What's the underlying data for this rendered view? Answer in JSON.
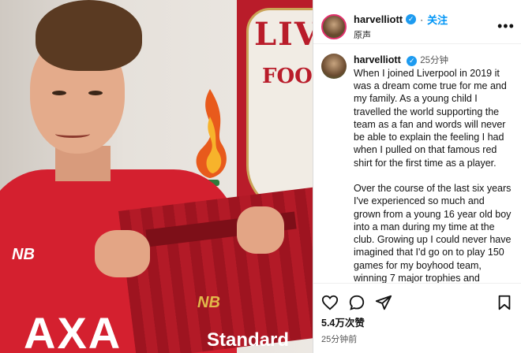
{
  "post": {
    "username": "harvelliott",
    "follow_label": "关注",
    "subtitle": "原声",
    "more_label": "•••",
    "caption_username": "harvelliott",
    "caption_time": "25分钟",
    "caption_text": "When I joined Liverpool in 2019 it was a dream come true for me and my family. As a young child I travelled the world supporting the team as a fan and words will never be able to explain the feeling I had when I pulled on that famous red shirt for the first time as a player.\n\nOver the course of the last six years I've experienced so much and grown from a young 16 year old boy into a man during my time at the club. Growing up I could never have imagined that I'd go on to play 150 games for my boyhood team, winning 7 major trophies and culminating in being part of the squad to have won the Premier League",
    "likes": "5.4万次赞",
    "posted_time": "25分钟前"
  },
  "photo": {
    "crest_text_top": "LIV",
    "crest_text_bottom": "FOOT",
    "shirt_brand_left": "NB",
    "shirt_sponsor_left": "AXA",
    "shirt_brand_right": "NB",
    "shirt_sponsor_right": "Standard"
  },
  "colors": {
    "liverpool_red": "#d4202f",
    "instagram_blue": "#0095f6",
    "verified_blue": "#1d9bf0"
  },
  "icons": [
    "heart-icon",
    "comment-icon",
    "share-icon",
    "bookmark-icon",
    "verified-icon",
    "more-icon"
  ]
}
